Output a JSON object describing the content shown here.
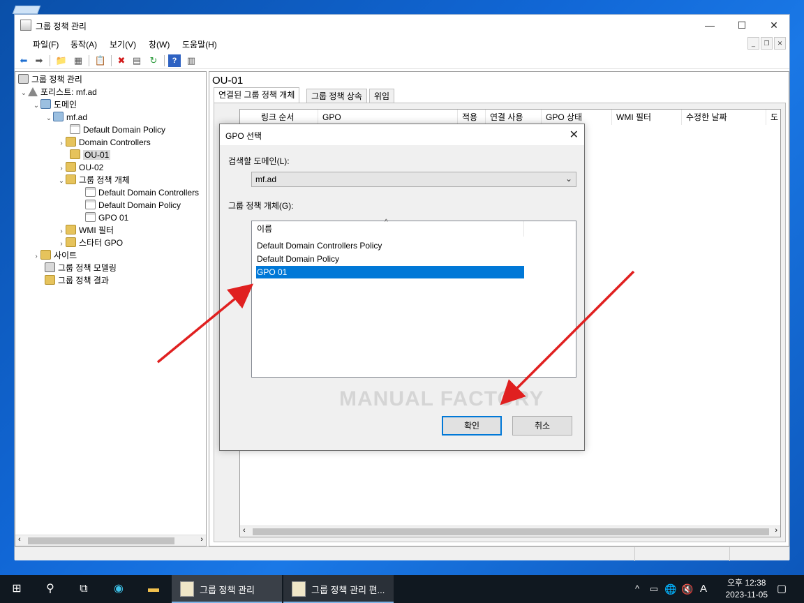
{
  "window": {
    "title": "그룹 정책 관리"
  },
  "menu": [
    "파일(F)",
    "동작(A)",
    "보기(V)",
    "창(W)",
    "도움말(H)"
  ],
  "tree": {
    "root": "그룹 정책 관리",
    "forest": "포리스트: mf.ad",
    "domains": "도메인",
    "domain": "mf.ad",
    "ddp": "Default Domain Policy",
    "dc": "Domain Controllers",
    "ou01": "OU-01",
    "ou02": "OU-02",
    "gpo_container": "그룹 정책 개체",
    "gpo1": "Default Domain Controllers",
    "gpo2": "Default Domain Policy",
    "gpo3": "GPO 01",
    "wmi": "WMI 필터",
    "starter": "스타터 GPO",
    "sites": "사이트",
    "modeling": "그룹 정책 모델링",
    "results": "그룹 정책 결과"
  },
  "right": {
    "title": "OU-01",
    "tabs": [
      "연결된 그룹 정책 개체",
      "그룹 정책 상속",
      "위임"
    ],
    "columns": [
      "링크 순서",
      "GPO",
      "적용",
      "연결 사용",
      "GPO 상태",
      "WMI 필터",
      "수정한 날짜",
      "도"
    ]
  },
  "dialog": {
    "title": "GPO 선택",
    "domain_label": "검색할 도메인(L):",
    "domain_value": "mf.ad",
    "list_label": "그룹 정책 개체(G):",
    "list_header": "이름",
    "items": [
      "Default Domain Controllers Policy",
      "Default Domain Policy",
      "GPO 01"
    ],
    "ok": "확인",
    "cancel": "취소",
    "watermark": "MANUAL FACTORY"
  },
  "taskbar": {
    "app1": "그룹 정책 관리",
    "app2": "그룹 정책 관리 편...",
    "ime": "A",
    "time": "오후 12:38",
    "date": "2023-11-05"
  },
  "colors": {
    "selection": "#0078d7",
    "arrow": "#e02020",
    "taskbar": "#101820"
  }
}
